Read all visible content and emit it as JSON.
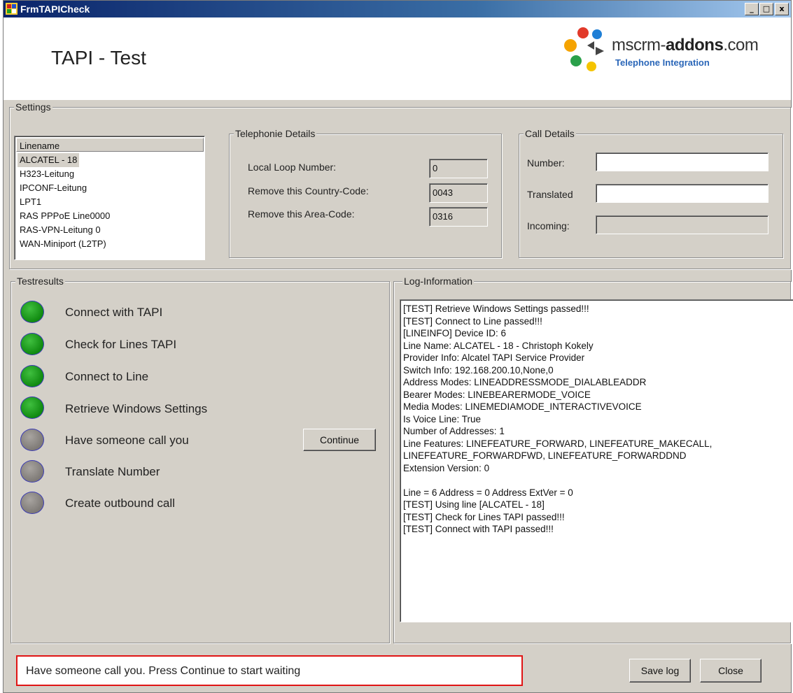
{
  "window": {
    "title": "FrmTAPICheck",
    "buttons": [
      "_",
      "□",
      "x"
    ]
  },
  "header": {
    "title": "TAPI - Test",
    "brand": {
      "name_prefix": "mscrm-",
      "name_bold": "addons",
      "name_suffix": ".com",
      "tagline": "Telephone Integration"
    }
  },
  "settings": {
    "label": "Settings",
    "lines": {
      "header": "Linename",
      "items": [
        "ALCATEL - 18",
        "H323-Leitung",
        "IPCONF-Leitung",
        "LPT1",
        "RAS PPPoE Line0000",
        "RAS-VPN-Leitung 0",
        "WAN-Miniport (L2TP)"
      ],
      "selected": "ALCATEL - 18"
    },
    "telephony": {
      "label": "Telephonie Details",
      "local_loop_label": "Local Loop Number:",
      "local_loop_value": "0",
      "country_code_label": "Remove this Country-Code:",
      "country_code_value": "0043",
      "area_code_label": "Remove this Area-Code:",
      "area_code_value": "0316"
    },
    "call": {
      "label": "Call Details",
      "number_label": "Number:",
      "number_value": "",
      "translated_label": "Translated",
      "translated_value": "",
      "incoming_label": "Incoming:",
      "incoming_value": ""
    }
  },
  "testresults": {
    "label": "Testresults",
    "steps": [
      {
        "text": "Connect with TAPI",
        "status": "passed"
      },
      {
        "text": "Check for Lines TAPI",
        "status": "passed"
      },
      {
        "text": "Connect to Line",
        "status": "passed"
      },
      {
        "text": "Retrieve Windows Settings",
        "status": "passed"
      },
      {
        "text": "Have someone call you",
        "status": "pending"
      },
      {
        "text": "Translate Number",
        "status": "pending"
      },
      {
        "text": "Create outbound call",
        "status": "pending"
      }
    ],
    "continue_label": "Continue",
    "colors": {
      "passed": "#108a10",
      "pending": "#7e7a76"
    }
  },
  "log": {
    "label": "Log-Information",
    "lines": [
      "[TEST] Retrieve Windows Settings passed!!!",
      "[TEST] Connect to Line passed!!!",
      "[LINEINFO] Device ID: 6",
      "Line Name: ALCATEL - 18 - Christoph Kokely",
      "Provider Info: Alcatel TAPI Service Provider",
      "Switch Info: 192.168.200.10,None,0",
      "Address Modes: LINEADDRESSMODE_DIALABLEADDR",
      "Bearer Modes: LINEBEARERMODE_VOICE",
      "Media Modes: LINEMEDIAMODE_INTERACTIVEVOICE",
      "Is Voice Line: True",
      "Number of Addresses: 1",
      "Line Features: LINEFEATURE_FORWARD, LINEFEATURE_MAKECALL,",
      "LINEFEATURE_FORWARDFWD, LINEFEATURE_FORWARDDND",
      "Extension Version: 0",
      "",
      "Line = 6 Address = 0 Address ExtVer = 0",
      "[TEST] Using line [ALCATEL - 18]",
      "[TEST] Check for Lines TAPI passed!!!",
      "[TEST] Connect with TAPI passed!!!"
    ]
  },
  "footer": {
    "status": "Have someone call you. Press Continue to start waiting",
    "save_label": "Save log",
    "close_label": "Close"
  }
}
